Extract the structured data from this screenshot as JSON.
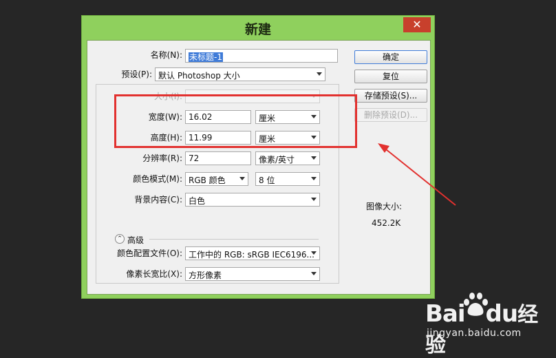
{
  "window": {
    "title": "新建",
    "close_symbol": "✕"
  },
  "form": {
    "name_label": "名称(N):",
    "name_value": "未标题-1",
    "preset_label": "预设(P):",
    "preset_value": "默认 Photoshop 大小",
    "size_label": "大小(I):",
    "size_value": "",
    "width_label": "宽度(W):",
    "width_value": "16.02",
    "width_unit": "厘米",
    "height_label": "高度(H):",
    "height_value": "11.99",
    "height_unit": "厘米",
    "resolution_label": "分辨率(R):",
    "resolution_value": "72",
    "resolution_unit": "像素/英寸",
    "color_mode_label": "颜色模式(M):",
    "color_mode_value": "RGB 颜色",
    "bit_depth_value": "8 位",
    "background_label": "背景内容(C):",
    "background_value": "白色",
    "advanced_label": "高级",
    "advanced_icon": "⌃",
    "color_profile_label": "颜色配置文件(O):",
    "color_profile_value": "工作中的 RGB: sRGB IEC6196...",
    "pixel_aspect_label": "像素长宽比(X):",
    "pixel_aspect_value": "方形像素"
  },
  "buttons": {
    "ok": "确定",
    "reset": "复位",
    "save_preset": "存储预设(S)...",
    "delete_preset": "删除预设(D)..."
  },
  "info": {
    "image_size_label": "图像大小:",
    "image_size_value": "452.2K"
  },
  "watermark": {
    "brand_left": "Bai",
    "brand_du": "du",
    "brand_right": "经验",
    "url": "jingyan.baidu.com"
  },
  "colors": {
    "window_frame": "#8fd05d",
    "close_button": "#c8402c",
    "highlight_box": "#e2312f",
    "selection": "#3f7bd8"
  }
}
